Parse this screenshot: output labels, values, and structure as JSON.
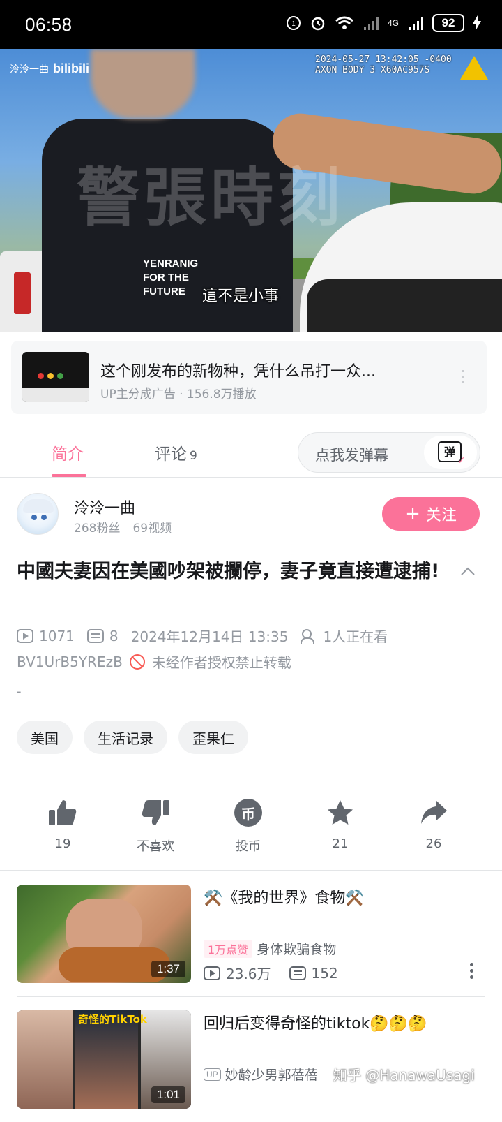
{
  "status_bar": {
    "time": "06:58",
    "network": "4G",
    "battery": "92"
  },
  "video": {
    "channel_logo": "泠泠一曲",
    "platform_logo": "bilibili",
    "bodycam_stamp_line1": "2024-05-27 13:42:05 -0400",
    "bodycam_stamp_line2": "AXON BODY 3 X60AC957S",
    "subtitle": "這不是小事",
    "watermark": "警張時刻",
    "shirt_text": "YENRANIG\nFOR THE\nFUTURE"
  },
  "ad": {
    "title": "这个刚发布的新物种，凭什么吊打一众...",
    "meta": "UP主分成广告 · 156.8万播放"
  },
  "tabs": {
    "intro": "简介",
    "comments": "评论",
    "comments_count": "9",
    "danmaku_placeholder": "点我发弹幕",
    "danmaku_button": "弹"
  },
  "uploader": {
    "name": "泠泠一曲",
    "fans": "268粉丝",
    "videos": "69视频",
    "follow_label": "关注"
  },
  "video_info": {
    "title": "中國夫妻因在美國吵架被攔停，妻子竟直接遭逮捕!",
    "views": "1071",
    "danmaku": "8",
    "date": "2024年12月14日 13:35",
    "watching": "1人正在看",
    "bvid": "BV1UrB5YREzB",
    "copyright": "未经作者授权禁止转载",
    "description": "-"
  },
  "tags": [
    "美国",
    "生活记录",
    "歪果仁"
  ],
  "actions": {
    "like": "19",
    "dislike": "不喜欢",
    "coin": "投币",
    "favorite": "21",
    "share": "26"
  },
  "recommendations": [
    {
      "title": "⚒️《我的世界》食物⚒️",
      "badge": "1万点赞",
      "subtitle": "身体欺骗食物",
      "duration": "1:37",
      "views": "23.6万",
      "danmaku": "152"
    },
    {
      "title": "回归后变得奇怪的tiktok🤔🤔🤔",
      "uploader": "妙龄少男郭蓓蓓",
      "duration": "1:01",
      "cover_text": "奇怪的TikTok"
    }
  ],
  "watermark_overlay": "知乎 @HanawaUsagi",
  "colors": {
    "accent": "#fb7299",
    "text_primary": "#18191c",
    "text_secondary": "#9499a0"
  }
}
